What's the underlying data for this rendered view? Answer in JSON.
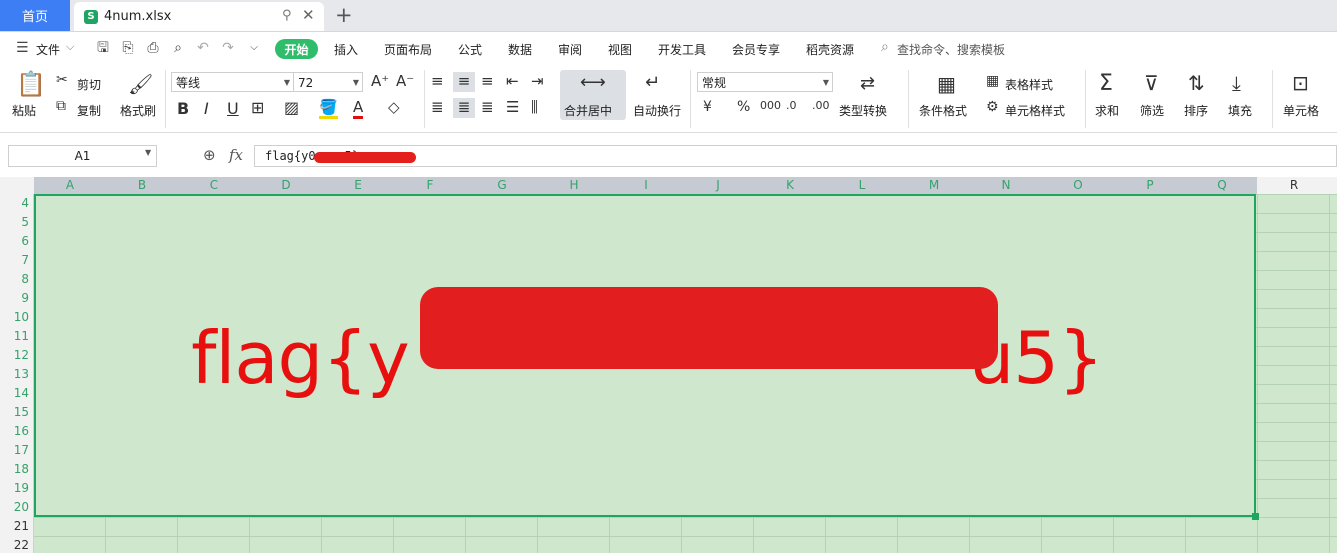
{
  "tabs": {
    "home": "首页",
    "file": "4num.xlsx",
    "file_icon": "S"
  },
  "menu": {
    "file": "文件",
    "items": [
      "开始",
      "插入",
      "页面布局",
      "公式",
      "数据",
      "审阅",
      "视图",
      "开发工具",
      "会员专享",
      "稻壳资源"
    ],
    "search_placeholder": "查找命令、搜索模板"
  },
  "ribbon": {
    "paste": "粘贴",
    "cut": "剪切",
    "copy": "复制",
    "format_painter": "格式刷",
    "font_name": "等线",
    "font_size": "72",
    "merge_center": "合并居中",
    "wrap_text": "自动换行",
    "number_format": "常规",
    "type_convert": "类型转换",
    "conditional_format": "条件格式",
    "table_style": "表格样式",
    "cell_style": "单元格样式",
    "sum": "求和",
    "filter": "筛选",
    "sort": "排序",
    "fill": "填充",
    "cell": "单元格"
  },
  "formula_bar": {
    "name_box": "A1",
    "fx": "fx",
    "content": "flag{y0 … u5}"
  },
  "sheet": {
    "columns": [
      "A",
      "B",
      "C",
      "D",
      "E",
      "F",
      "G",
      "H",
      "I",
      "J",
      "K",
      "L",
      "M",
      "N",
      "O",
      "P",
      "Q",
      "R"
    ],
    "rows": [
      "4",
      "5",
      "6",
      "7",
      "8",
      "9",
      "10",
      "11",
      "12",
      "13",
      "14",
      "15",
      "16",
      "17",
      "18",
      "19",
      "20",
      "21",
      "22"
    ],
    "cell_text_prefix": "flag{y",
    "cell_text_suffix": "u5}"
  },
  "colors": {
    "accent_green": "#2fbc6b",
    "home_tab": "#3d7ef5",
    "cell_fill": "#cfe8cd",
    "flag_text": "#e80f0f",
    "redaction": "#e31e1e"
  }
}
